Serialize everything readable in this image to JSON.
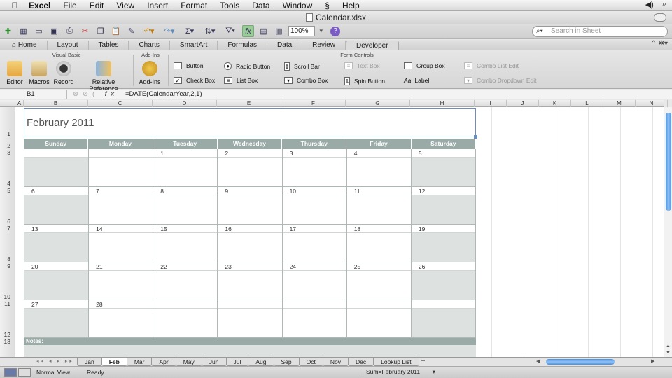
{
  "menubar": {
    "app": "Excel",
    "items": [
      "File",
      "Edit",
      "View",
      "Insert",
      "Format",
      "Tools",
      "Data",
      "Window",
      "Help"
    ]
  },
  "title": "Calendar.xlsx",
  "toolbar": {
    "zoom": "100%",
    "search_placeholder": "Search in Sheet"
  },
  "ribbon_tabs": [
    "Home",
    "Layout",
    "Tables",
    "Charts",
    "SmartArt",
    "Formulas",
    "Data",
    "Review",
    "Developer"
  ],
  "active_ribbon_tab": "Developer",
  "ribbon": {
    "groups": {
      "visual_basic": "Visual Basic",
      "add_ins": "Add-Ins",
      "form_controls": "Form Controls"
    },
    "buttons": {
      "editor": "Editor",
      "macros": "Macros",
      "record": "Record",
      "relative_reference": "Relative Reference",
      "add_ins": "Add-Ins"
    },
    "controls": {
      "button": "Button",
      "check_box": "Check Box",
      "radio_button": "Radio Button",
      "list_box": "List Box",
      "scroll_bar": "Scroll Bar",
      "combo_box": "Combo Box",
      "text_box": "Text Box",
      "spin_button": "Spin Button",
      "group_box": "Group Box",
      "label": "Label",
      "combo_list_edit": "Combo List Edit",
      "combo_dropdown_edit": "Combo Dropdown Edit"
    }
  },
  "formula_bar": {
    "name_box": "B1",
    "fx": "fx",
    "formula": "=DATE(CalendarYear,2,1)"
  },
  "columns": [
    "A",
    "B",
    "C",
    "D",
    "E",
    "F",
    "G",
    "H",
    "I",
    "J",
    "K",
    "L",
    "M",
    "N"
  ],
  "rows": [
    "1",
    "2",
    "3",
    "4",
    "5",
    "6",
    "7",
    "8",
    "9",
    "10",
    "11",
    "12",
    "13"
  ],
  "calendar": {
    "title": "February 2011",
    "days": [
      "Sunday",
      "Monday",
      "Tuesday",
      "Wednesday",
      "Thursday",
      "Friday",
      "Saturday"
    ],
    "weeks": [
      [
        "",
        "",
        "1",
        "2",
        "3",
        "4",
        "5"
      ],
      [
        "6",
        "7",
        "8",
        "9",
        "10",
        "11",
        "12"
      ],
      [
        "13",
        "14",
        "15",
        "16",
        "17",
        "18",
        "19"
      ],
      [
        "20",
        "21",
        "22",
        "23",
        "24",
        "25",
        "26"
      ],
      [
        "27",
        "28",
        "",
        "",
        "",
        "",
        ""
      ]
    ],
    "notes_label": "Notes:"
  },
  "sheet_tabs": [
    "Jan",
    "Feb",
    "Mar",
    "Apr",
    "May",
    "Jun",
    "Jul",
    "Aug",
    "Sep",
    "Oct",
    "Nov",
    "Dec",
    "Lookup List"
  ],
  "active_sheet": "Feb",
  "status": {
    "view": "Normal View",
    "state": "Ready",
    "sum": "Sum=February 2011"
  },
  "colors": {
    "day_header": "#9aaaa6",
    "weekend": "#dde2e0",
    "selection": "#6c8ebf",
    "scrollbar": "#4a8fe0"
  }
}
